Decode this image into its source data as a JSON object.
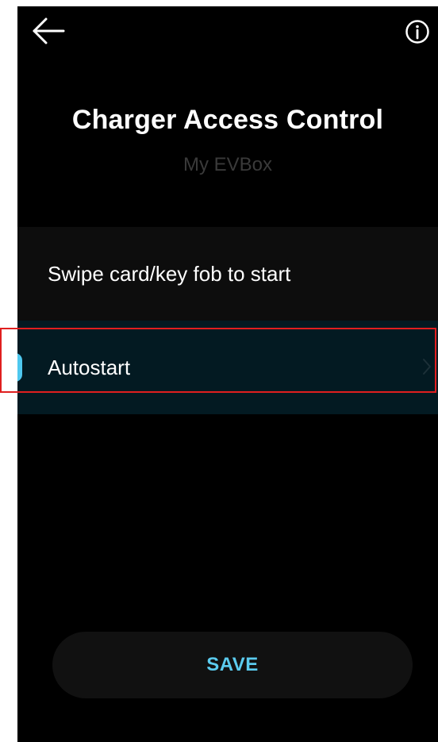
{
  "header": {
    "back_icon": "arrow-left-icon",
    "info_icon": "info-circle-icon",
    "title": "Charger Access Control",
    "subtitle": "My EVBox"
  },
  "options": [
    {
      "label": "Swipe card/key fob to start",
      "selected": false
    },
    {
      "label": "Autostart",
      "selected": true
    }
  ],
  "footer": {
    "save_label": "SAVE"
  },
  "colors": {
    "background": "#000000",
    "accent": "#4fc8ef",
    "selected_row": "#031a22",
    "row": "#0d0d0d",
    "highlight": "#e01f1f"
  }
}
